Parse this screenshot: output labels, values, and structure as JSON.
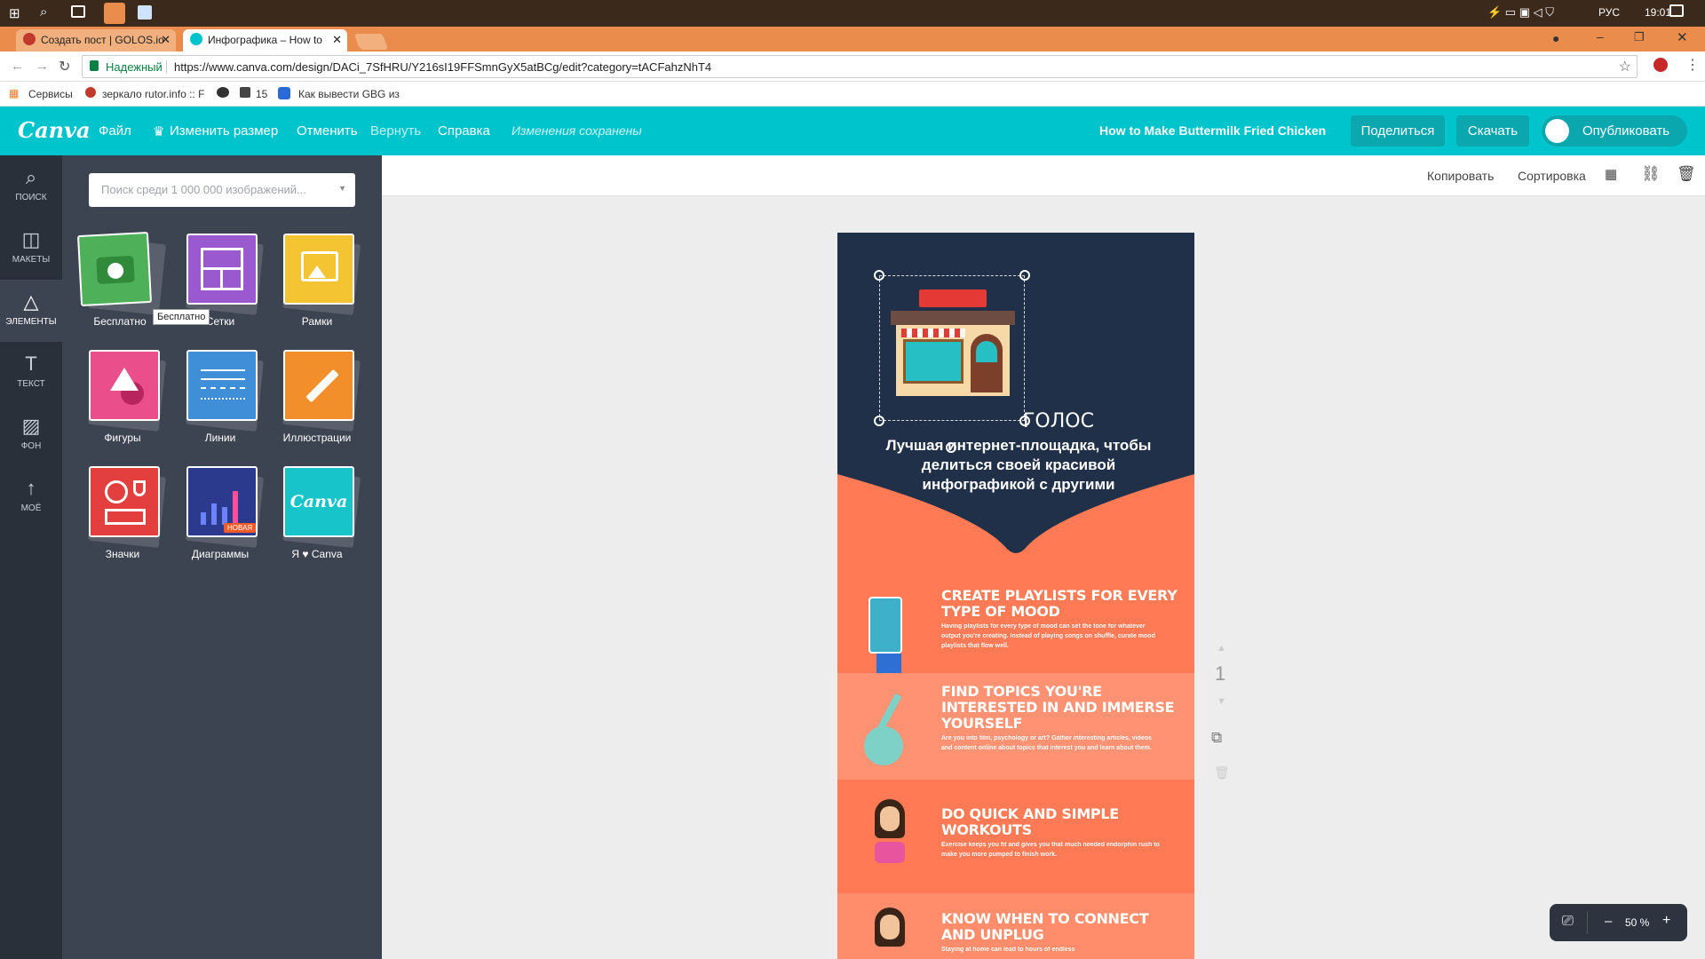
{
  "taskbar": {
    "lang": "РУС",
    "time": "19:01"
  },
  "tabs": [
    {
      "label": "Создать пост | GOLOS.io",
      "close": "✕"
    },
    {
      "label": "Инфографика – How to",
      "close": "✕"
    }
  ],
  "address": {
    "secure_label": "Надежный",
    "url": "https://www.canva.com/design/DACi_7SfHRU/Y216sI19FFSmnGyX5atBCg/edit?category=tACFahzNhT4"
  },
  "bookmarks": [
    "Сервисы",
    "зеркало rutor.info :: F",
    "15",
    "Как вывести GBG из"
  ],
  "topbar": {
    "logo": "Canva",
    "menu": [
      "Файл",
      "Изменить размер",
      "Отменить",
      "Вернуть",
      "Справка"
    ],
    "saved_status": "Изменения сохранены",
    "design_title": "How to Make Buttermilk Fried Chicken",
    "share": "Поделиться",
    "download": "Скачать",
    "publish": "Опубликовать"
  },
  "sidebar": [
    {
      "label": "ПОИСК",
      "icon": "search-icon"
    },
    {
      "label": "МАКЕТЫ",
      "icon": "layouts-icon"
    },
    {
      "label": "ЭЛЕМЕНТЫ",
      "icon": "elements-icon"
    },
    {
      "label": "ТЕКСТ",
      "icon": "text-icon"
    },
    {
      "label": "ФОН",
      "icon": "background-icon"
    },
    {
      "label": "МОЁ",
      "icon": "upload-icon"
    }
  ],
  "panel": {
    "search_placeholder": "Поиск среди 1 000 000 изображений...",
    "tiles": [
      {
        "label": "Бесплатно",
        "color": "#4fb05a"
      },
      {
        "label": "Сетки",
        "color": "#9b59d0"
      },
      {
        "label": "Рамки",
        "color": "#f5c432"
      },
      {
        "label": "Фигуры",
        "color": "#ea4f8c"
      },
      {
        "label": "Линии",
        "color": "#3f8fd8"
      },
      {
        "label": "Иллюстрации",
        "color": "#f38f2a"
      },
      {
        "label": "Значки",
        "color": "#e43f3f"
      },
      {
        "label": "Диаграммы",
        "color": "#2b3a8c",
        "badge": "НОВАЯ"
      },
      {
        "label": "Я ♥ Canva",
        "color": "#16c4c9",
        "logo": "Canva"
      }
    ],
    "tooltip": "Бесплатно"
  },
  "canvas_toolbar": {
    "copy": "Копировать",
    "sort": "Сортировка"
  },
  "design": {
    "header_title": "ГОЛОС",
    "header_subtitle": "Лучшая интернет-площадка, чтобы делиться своей красивой инфографикой с другими",
    "header_color": "#1f3048",
    "sections": [
      {
        "title": "CREATE PLAYLISTS FOR EVERY TYPE OF MOOD",
        "body": "Having playlists for every type of mood can set the tone for whatever output you're creating. Instead of playing songs on shuffle, curate mood playlists that flow well."
      },
      {
        "title": "FIND TOPICS YOU'RE INTERESTED IN AND IMMERSE YOURSELF",
        "body": "Are you into film, psychology or art? Gather interesting articles, videos and content online about topics that interest you and learn about them."
      },
      {
        "title": "DO QUICK AND SIMPLE WORKOUTS",
        "body": "Exercise keeps you fit and gives you that much needed endorphin rush to make you more pumped to finish work."
      },
      {
        "title": "KNOW WHEN TO CONNECT AND UNPLUG",
        "body": "Staying at home can lead to hours of endless"
      }
    ]
  },
  "page_number": "1",
  "zoom": {
    "value": "50 %",
    "minus": "–",
    "plus": "+"
  }
}
